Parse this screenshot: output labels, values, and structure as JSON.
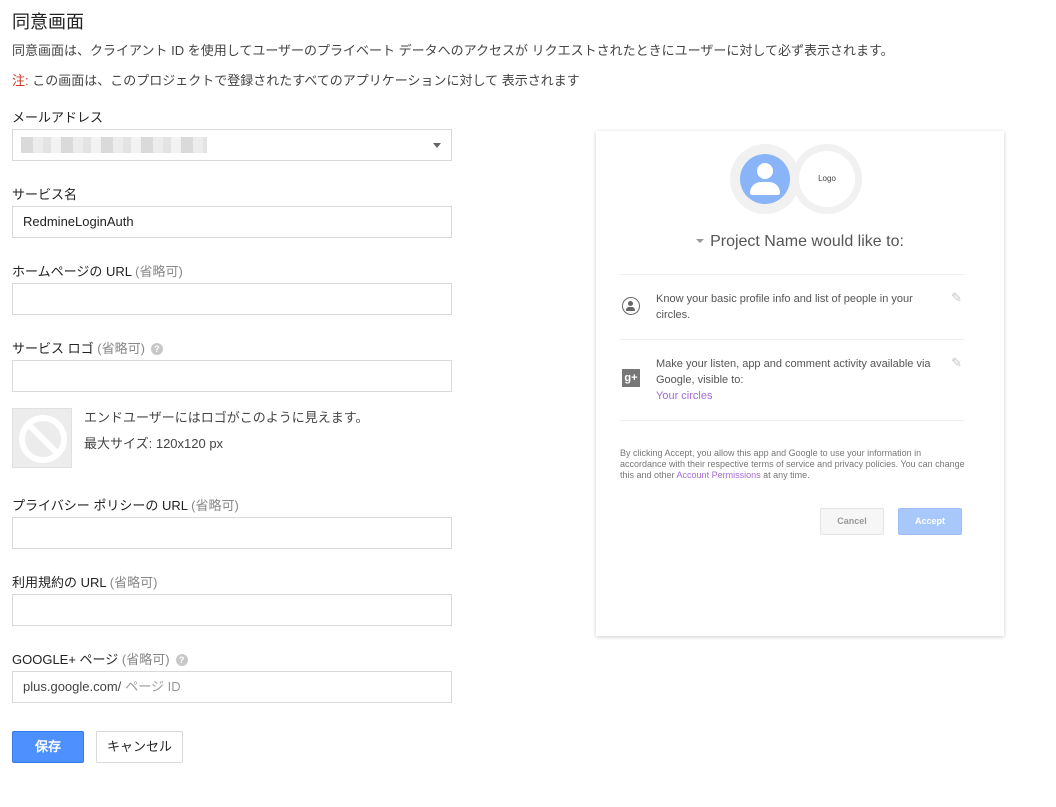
{
  "header": {
    "title": "同意画面",
    "description": "同意画面は、クライアント ID を使用してユーザーのプライベート データへのアクセスが リクエストされたときにユーザーに対して必ず表示されます。",
    "note_prefix": "注:",
    "note_text": " この画面は、このプロジェクトで登録されたすべてのアプリケーションに対して 表示されます"
  },
  "form": {
    "email": {
      "label": "メールアドレス"
    },
    "service_name": {
      "label": "サービス名",
      "value": "RedmineLoginAuth"
    },
    "homepage": {
      "label": "ホームページの URL",
      "optional": "(省略可)",
      "value": ""
    },
    "logo": {
      "label": "サービス ロゴ",
      "optional": "(省略可)",
      "help_icon": "question-icon",
      "value": "",
      "preview_text": "エンドユーザーにはロゴがこのように見えます。",
      "max_size": "最大サイズ: 120x120 px"
    },
    "privacy": {
      "label": "プライバシー ポリシーの URL",
      "optional": "(省略可)",
      "value": ""
    },
    "terms": {
      "label": "利用規約の URL",
      "optional": "(省略可)",
      "value": ""
    },
    "gplus": {
      "label": "GOOGLE+ ページ",
      "optional": "(省略可)",
      "help_icon": "question-icon",
      "prefix": "plus.google.com/",
      "placeholder": "ページ ID"
    },
    "save_label": "保存",
    "cancel_label": "キャンセル"
  },
  "preview": {
    "logo_text": "Logo",
    "project_line": "Project Name would like to:",
    "permissions": [
      {
        "icon": "profile-icon",
        "text": "Know your basic profile info and list of people in your circles.",
        "link": ""
      },
      {
        "icon": "google-plus-icon",
        "text": "Make your listen, app and comment activity available via Google, visible to:",
        "link": "Your circles"
      }
    ],
    "disclaimer_before": "By clicking Accept, you allow this app and Google to use your information in accordance with their respective terms of service and privacy policies. You can change this and other ",
    "disclaimer_link": "Account Permissions",
    "disclaimer_after": " at any time.",
    "cancel_label": "Cancel",
    "accept_label": "Accept"
  },
  "colors": {
    "primary_button": "#4d90fe",
    "note_red": "#c53929",
    "link_purple": "#a66ad1",
    "accept_disabled": "#a8c7fa"
  }
}
